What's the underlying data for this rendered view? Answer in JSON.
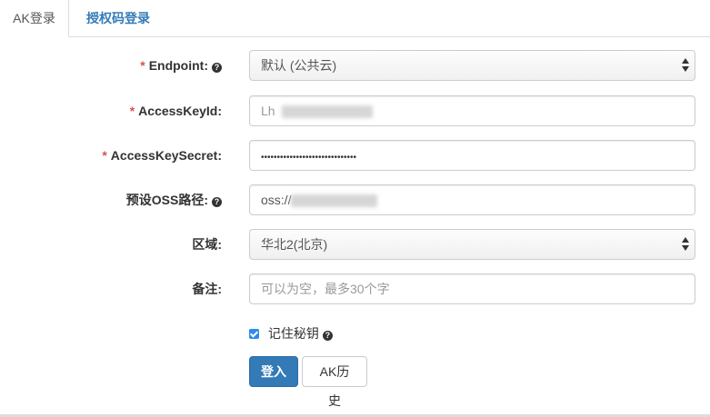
{
  "tabs": {
    "ak_login": "AK登录",
    "auth_code_login": "授权码登录"
  },
  "form": {
    "required_mark": "*",
    "endpoint": {
      "label": "Endpoint:",
      "selected": "默认 (公共云)"
    },
    "access_key_id": {
      "label": "AccessKeyId:",
      "value_prefix": "Lh"
    },
    "access_key_secret": {
      "label": "AccessKeySecret:",
      "value": "••••••••••••••••••••••••••••••"
    },
    "oss_path": {
      "label": "预设OSS路径:",
      "value_prefix": "oss://"
    },
    "region": {
      "label": "区域:",
      "selected": "华北2(北京)"
    },
    "note": {
      "label": "备注:",
      "placeholder": "可以为空，最多30个字"
    },
    "remember_key": {
      "label": "记住秘钥",
      "checked": true
    }
  },
  "buttons": {
    "login": "登入",
    "ak_history": "AK历史"
  },
  "icons": {
    "help": "question-circle-icon",
    "select_arrows": "select-arrows-icon",
    "checkbox": "checkbox-icon"
  },
  "colors": {
    "primary": "#337ab7",
    "required": "#d9534f",
    "checkbox": "#2f8ce6"
  }
}
